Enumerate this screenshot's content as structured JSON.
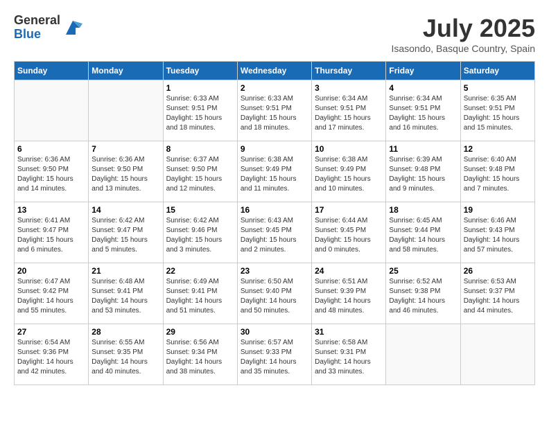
{
  "logo": {
    "general": "General",
    "blue": "Blue"
  },
  "title": "July 2025",
  "location": "Isasondo, Basque Country, Spain",
  "days_of_week": [
    "Sunday",
    "Monday",
    "Tuesday",
    "Wednesday",
    "Thursday",
    "Friday",
    "Saturday"
  ],
  "weeks": [
    [
      {
        "day": "",
        "info": ""
      },
      {
        "day": "",
        "info": ""
      },
      {
        "day": "1",
        "info": "Sunrise: 6:33 AM\nSunset: 9:51 PM\nDaylight: 15 hours and 18 minutes."
      },
      {
        "day": "2",
        "info": "Sunrise: 6:33 AM\nSunset: 9:51 PM\nDaylight: 15 hours and 18 minutes."
      },
      {
        "day": "3",
        "info": "Sunrise: 6:34 AM\nSunset: 9:51 PM\nDaylight: 15 hours and 17 minutes."
      },
      {
        "day": "4",
        "info": "Sunrise: 6:34 AM\nSunset: 9:51 PM\nDaylight: 15 hours and 16 minutes."
      },
      {
        "day": "5",
        "info": "Sunrise: 6:35 AM\nSunset: 9:51 PM\nDaylight: 15 hours and 15 minutes."
      }
    ],
    [
      {
        "day": "6",
        "info": "Sunrise: 6:36 AM\nSunset: 9:50 PM\nDaylight: 15 hours and 14 minutes."
      },
      {
        "day": "7",
        "info": "Sunrise: 6:36 AM\nSunset: 9:50 PM\nDaylight: 15 hours and 13 minutes."
      },
      {
        "day": "8",
        "info": "Sunrise: 6:37 AM\nSunset: 9:50 PM\nDaylight: 15 hours and 12 minutes."
      },
      {
        "day": "9",
        "info": "Sunrise: 6:38 AM\nSunset: 9:49 PM\nDaylight: 15 hours and 11 minutes."
      },
      {
        "day": "10",
        "info": "Sunrise: 6:38 AM\nSunset: 9:49 PM\nDaylight: 15 hours and 10 minutes."
      },
      {
        "day": "11",
        "info": "Sunrise: 6:39 AM\nSunset: 9:48 PM\nDaylight: 15 hours and 9 minutes."
      },
      {
        "day": "12",
        "info": "Sunrise: 6:40 AM\nSunset: 9:48 PM\nDaylight: 15 hours and 7 minutes."
      }
    ],
    [
      {
        "day": "13",
        "info": "Sunrise: 6:41 AM\nSunset: 9:47 PM\nDaylight: 15 hours and 6 minutes."
      },
      {
        "day": "14",
        "info": "Sunrise: 6:42 AM\nSunset: 9:47 PM\nDaylight: 15 hours and 5 minutes."
      },
      {
        "day": "15",
        "info": "Sunrise: 6:42 AM\nSunset: 9:46 PM\nDaylight: 15 hours and 3 minutes."
      },
      {
        "day": "16",
        "info": "Sunrise: 6:43 AM\nSunset: 9:45 PM\nDaylight: 15 hours and 2 minutes."
      },
      {
        "day": "17",
        "info": "Sunrise: 6:44 AM\nSunset: 9:45 PM\nDaylight: 15 hours and 0 minutes."
      },
      {
        "day": "18",
        "info": "Sunrise: 6:45 AM\nSunset: 9:44 PM\nDaylight: 14 hours and 58 minutes."
      },
      {
        "day": "19",
        "info": "Sunrise: 6:46 AM\nSunset: 9:43 PM\nDaylight: 14 hours and 57 minutes."
      }
    ],
    [
      {
        "day": "20",
        "info": "Sunrise: 6:47 AM\nSunset: 9:42 PM\nDaylight: 14 hours and 55 minutes."
      },
      {
        "day": "21",
        "info": "Sunrise: 6:48 AM\nSunset: 9:41 PM\nDaylight: 14 hours and 53 minutes."
      },
      {
        "day": "22",
        "info": "Sunrise: 6:49 AM\nSunset: 9:41 PM\nDaylight: 14 hours and 51 minutes."
      },
      {
        "day": "23",
        "info": "Sunrise: 6:50 AM\nSunset: 9:40 PM\nDaylight: 14 hours and 50 minutes."
      },
      {
        "day": "24",
        "info": "Sunrise: 6:51 AM\nSunset: 9:39 PM\nDaylight: 14 hours and 48 minutes."
      },
      {
        "day": "25",
        "info": "Sunrise: 6:52 AM\nSunset: 9:38 PM\nDaylight: 14 hours and 46 minutes."
      },
      {
        "day": "26",
        "info": "Sunrise: 6:53 AM\nSunset: 9:37 PM\nDaylight: 14 hours and 44 minutes."
      }
    ],
    [
      {
        "day": "27",
        "info": "Sunrise: 6:54 AM\nSunset: 9:36 PM\nDaylight: 14 hours and 42 minutes."
      },
      {
        "day": "28",
        "info": "Sunrise: 6:55 AM\nSunset: 9:35 PM\nDaylight: 14 hours and 40 minutes."
      },
      {
        "day": "29",
        "info": "Sunrise: 6:56 AM\nSunset: 9:34 PM\nDaylight: 14 hours and 38 minutes."
      },
      {
        "day": "30",
        "info": "Sunrise: 6:57 AM\nSunset: 9:33 PM\nDaylight: 14 hours and 35 minutes."
      },
      {
        "day": "31",
        "info": "Sunrise: 6:58 AM\nSunset: 9:31 PM\nDaylight: 14 hours and 33 minutes."
      },
      {
        "day": "",
        "info": ""
      },
      {
        "day": "",
        "info": ""
      }
    ]
  ]
}
